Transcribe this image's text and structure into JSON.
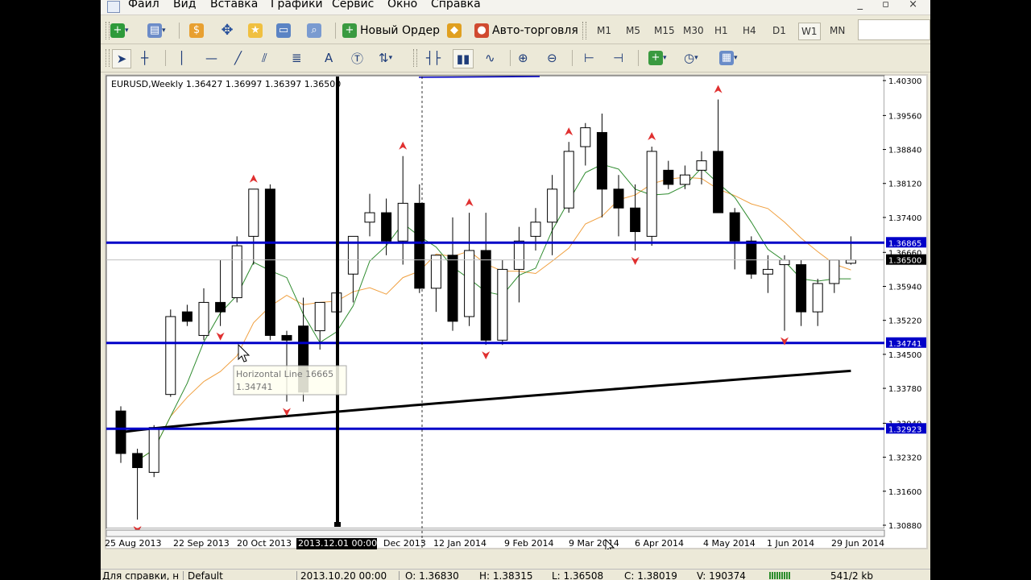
{
  "menu": [
    "Файл",
    "Вид",
    "Вставка",
    "Графики",
    "Сервис",
    "Окно",
    "Справка"
  ],
  "window_controls": "_ ▫ ×",
  "toolbar": {
    "new_order_label": "Новый Ордер",
    "auto_trading_label": "Авто-торговля",
    "timeframes": [
      "M1",
      "M5",
      "M15",
      "M30",
      "H1",
      "H4",
      "D1",
      "W1",
      "MN"
    ],
    "active_timeframe": "W1"
  },
  "chart": {
    "header": "EURUSD,Weekly  1.36427 1.36997 1.36397 1.36500",
    "price_labels": [
      "1.40300",
      "1.39560",
      "1.38840",
      "1.38120",
      "1.37400",
      "1.36865",
      "1.36660",
      "1.36500",
      "1.35940",
      "1.35220",
      "1.34741",
      "1.34500",
      "1.33780",
      "1.33040",
      "1.32923",
      "1.32320",
      "1.31600",
      "1.30880"
    ],
    "highlight_labels": {
      "line_high": "1.36865",
      "current": "1.36500",
      "line_mid": "1.34741",
      "line_low": "1.32923"
    },
    "date_labels": [
      "25 Aug 2013",
      "22 Sep 2013",
      "20 Oct 2013",
      "2013.12.01 00:00",
      "Dec 2013",
      "12 Jan 2014",
      "9 Feb 2014",
      "9 Mar 2014",
      "6 Apr 2014",
      "4 May 2014",
      "1 Jun 2014",
      "29 Jun 2014"
    ],
    "tooltip": {
      "line1": "Horizontal Line 16665",
      "line2": "1.34741"
    },
    "colors": {
      "bg": "#ffffff",
      "hline": "#0000c8",
      "ma_fast": "#2e8b2e",
      "ma_slow": "#f0a040",
      "ma_long": "#000000",
      "arrow": "#e03030"
    }
  },
  "chart_data": {
    "type": "candlestick",
    "symbol": "EURUSD",
    "timeframe": "Weekly",
    "ylim": [
      1.3088,
      1.403
    ],
    "x_labels": [
      "25 Aug 2013",
      "22 Sep 2013",
      "20 Oct 2013",
      "Dec 2013",
      "12 Jan 2014",
      "9 Feb 2014",
      "9 Mar 2014",
      "6 Apr 2014",
      "4 May 2014",
      "1 Jun 2014",
      "29 Jun 2014"
    ],
    "horizontal_lines": [
      1.36865,
      1.34741,
      1.32923
    ],
    "last_price": 1.365,
    "candles": [
      {
        "o": 1.333,
        "h": 1.334,
        "l": 1.322,
        "c": 1.324
      },
      {
        "o": 1.324,
        "h": 1.325,
        "l": 1.31,
        "c": 1.321
      },
      {
        "o": 1.32,
        "h": 1.33,
        "l": 1.319,
        "c": 1.3295
      },
      {
        "o": 1.3365,
        "h": 1.3545,
        "l": 1.336,
        "c": 1.353
      },
      {
        "o": 1.354,
        "h": 1.3555,
        "l": 1.351,
        "c": 1.352
      },
      {
        "o": 1.349,
        "h": 1.359,
        "l": 1.348,
        "c": 1.356
      },
      {
        "o": 1.356,
        "h": 1.365,
        "l": 1.351,
        "c": 1.354
      },
      {
        "o": 1.357,
        "h": 1.37,
        "l": 1.356,
        "c": 1.368
      },
      {
        "o": 1.37,
        "h": 1.38,
        "l": 1.364,
        "c": 1.38
      },
      {
        "o": 1.38,
        "h": 1.381,
        "l": 1.348,
        "c": 1.349
      },
      {
        "o": 1.349,
        "h": 1.35,
        "l": 1.335,
        "c": 1.348
      },
      {
        "o": 1.351,
        "h": 1.357,
        "l": 1.335,
        "c": 1.337
      },
      {
        "o": 1.35,
        "h": 1.356,
        "l": 1.346,
        "c": 1.356
      },
      {
        "o": 1.354,
        "h": 1.362,
        "l": 1.35,
        "c": 1.358
      },
      {
        "o": 1.362,
        "h": 1.37,
        "l": 1.356,
        "c": 1.37
      },
      {
        "o": 1.373,
        "h": 1.379,
        "l": 1.37,
        "c": 1.375
      },
      {
        "o": 1.375,
        "h": 1.378,
        "l": 1.366,
        "c": 1.369
      },
      {
        "o": 1.369,
        "h": 1.387,
        "l": 1.364,
        "c": 1.377
      },
      {
        "o": 1.377,
        "h": 1.381,
        "l": 1.358,
        "c": 1.359
      },
      {
        "o": 1.359,
        "h": 1.366,
        "l": 1.354,
        "c": 1.366
      },
      {
        "o": 1.366,
        "h": 1.374,
        "l": 1.35,
        "c": 1.352
      },
      {
        "o": 1.353,
        "h": 1.375,
        "l": 1.351,
        "c": 1.367
      },
      {
        "o": 1.367,
        "h": 1.375,
        "l": 1.347,
        "c": 1.348
      },
      {
        "o": 1.348,
        "h": 1.365,
        "l": 1.347,
        "c": 1.363
      },
      {
        "o": 1.363,
        "h": 1.372,
        "l": 1.356,
        "c": 1.369
      },
      {
        "o": 1.37,
        "h": 1.376,
        "l": 1.367,
        "c": 1.373
      },
      {
        "o": 1.373,
        "h": 1.383,
        "l": 1.366,
        "c": 1.38
      },
      {
        "o": 1.376,
        "h": 1.39,
        "l": 1.375,
        "c": 1.388
      },
      {
        "o": 1.389,
        "h": 1.394,
        "l": 1.385,
        "c": 1.393
      },
      {
        "o": 1.392,
        "h": 1.396,
        "l": 1.374,
        "c": 1.38
      },
      {
        "o": 1.38,
        "h": 1.383,
        "l": 1.37,
        "c": 1.376
      },
      {
        "o": 1.376,
        "h": 1.381,
        "l": 1.367,
        "c": 1.371
      },
      {
        "o": 1.37,
        "h": 1.389,
        "l": 1.368,
        "c": 1.388
      },
      {
        "o": 1.384,
        "h": 1.386,
        "l": 1.38,
        "c": 1.381
      },
      {
        "o": 1.381,
        "h": 1.385,
        "l": 1.38,
        "c": 1.383
      },
      {
        "o": 1.384,
        "h": 1.388,
        "l": 1.381,
        "c": 1.386
      },
      {
        "o": 1.388,
        "h": 1.399,
        "l": 1.375,
        "c": 1.375
      },
      {
        "o": 1.375,
        "h": 1.376,
        "l": 1.363,
        "c": 1.369
      },
      {
        "o": 1.369,
        "h": 1.37,
        "l": 1.361,
        "c": 1.362
      },
      {
        "o": 1.362,
        "h": 1.366,
        "l": 1.358,
        "c": 1.363
      },
      {
        "o": 1.364,
        "h": 1.366,
        "l": 1.35,
        "c": 1.365
      },
      {
        "o": 1.364,
        "h": 1.365,
        "l": 1.351,
        "c": 1.354
      },
      {
        "o": 1.354,
        "h": 1.361,
        "l": 1.351,
        "c": 1.36
      },
      {
        "o": 1.36,
        "h": 1.365,
        "l": 1.358,
        "c": 1.365
      },
      {
        "o": 1.3643,
        "h": 1.37,
        "l": 1.364,
        "c": 1.365
      }
    ]
  },
  "status": {
    "help": "Для справки, н",
    "profile": "Default",
    "datetime": "2013.10.20 00:00",
    "open": "O: 1.36830",
    "high": "H: 1.38315",
    "low": "L: 1.36508",
    "close": "C: 1.38019",
    "volume": "V: 190374",
    "traffic": "541/2 kb"
  }
}
